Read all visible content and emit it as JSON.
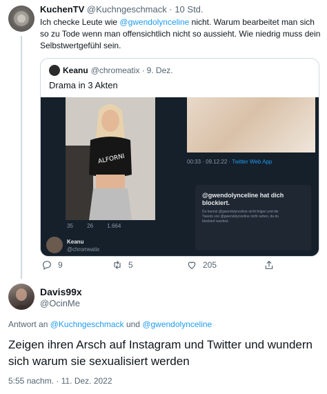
{
  "tweet1": {
    "display_name": "KuchenTV",
    "handle": "@Kuchngeschmack",
    "separator": "·",
    "time": "10 Std.",
    "text_before": "Ich checke Leute wie ",
    "mention": "@gwendolynceline",
    "text_after": " nicht. Warum bearbeitet man sich so zu Tode wenn man offensichtlich nicht so aussieht. Wie niedrig muss dein Selbstwertgefühl sein."
  },
  "quote": {
    "display_name": "Keanu",
    "handle": "@chromeatix",
    "separator": "·",
    "time": "9. Dez.",
    "text": "Drama in 3 Akten",
    "media": {
      "left_actions": [
        "35",
        "26",
        "1.664"
      ],
      "left_user_name": "Keanu",
      "left_user_handle": "@chromeatix",
      "top_right_meta_time": "00:33 · 09.12.22 · ",
      "top_right_meta_source": "Twitter Web App",
      "blocked_title": "@gwendolynceline hat dich blockiert.",
      "blocked_body": "Du kannst @gwendolynceline nicht folgen und die Tweets von @gwendolynceline nicht sehen, da du blockiert wurdest."
    }
  },
  "actions": {
    "replies": "9",
    "retweets": "5",
    "likes": "205"
  },
  "tweet2": {
    "display_name": "Davis99x",
    "handle": "@OcinMe",
    "reply_prefix": "Antwort an ",
    "reply_mention1": "@Kuchngeschmack",
    "reply_and": " und ",
    "reply_mention2": "@gwendolynceline",
    "text": "Zeigen ihren Arsch auf Instagram und Twitter und wundern sich warum sie sexualisiert werden",
    "timestamp": "5:55 nachm. · 11. Dez. 2022"
  },
  "colors": {
    "link": "#1d9bf0",
    "secondary_text": "#536471",
    "primary_text": "#0f1419",
    "dark_media_bg": "#15202b"
  },
  "icons": [
    "reply-icon",
    "retweet-icon",
    "like-icon",
    "share-icon"
  ]
}
